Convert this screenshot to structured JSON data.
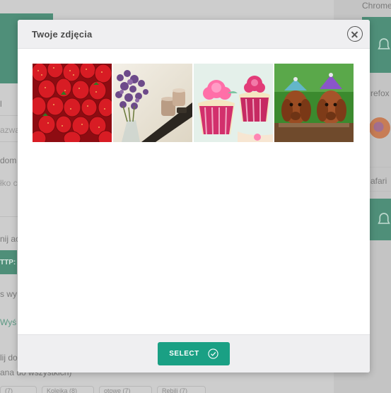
{
  "background": {
    "right_labels": [
      "Chrome",
      "refox",
      "afari"
    ],
    "left_labels": [
      "l",
      "azwa",
      "dom",
      "łko c",
      "nij ac",
      "s wy",
      "lij do",
      "ana do wszystkich)"
    ],
    "http_label": "TTP:",
    "green_link": "Wyś",
    "chips": [
      "(7)",
      "Kolejka (8)",
      "otowe (7)",
      "Rebili (7)"
    ]
  },
  "modal": {
    "title": "Twoje zdjęcia",
    "close_icon": "close-icon",
    "photos": [
      {
        "name": "photo-strawberries",
        "subject": "strawberries"
      },
      {
        "name": "photo-lavender-candles",
        "subject": "lavender and candles"
      },
      {
        "name": "photo-cupcakes",
        "subject": "cupcakes"
      },
      {
        "name": "photo-puppies",
        "subject": "dachshund puppies"
      }
    ],
    "select_label": "SELECT",
    "select_icon": "check-circle-icon"
  },
  "colors": {
    "accent": "#1aa084",
    "header_bg": "#efeff1",
    "bg_green": "#4f8f79"
  }
}
